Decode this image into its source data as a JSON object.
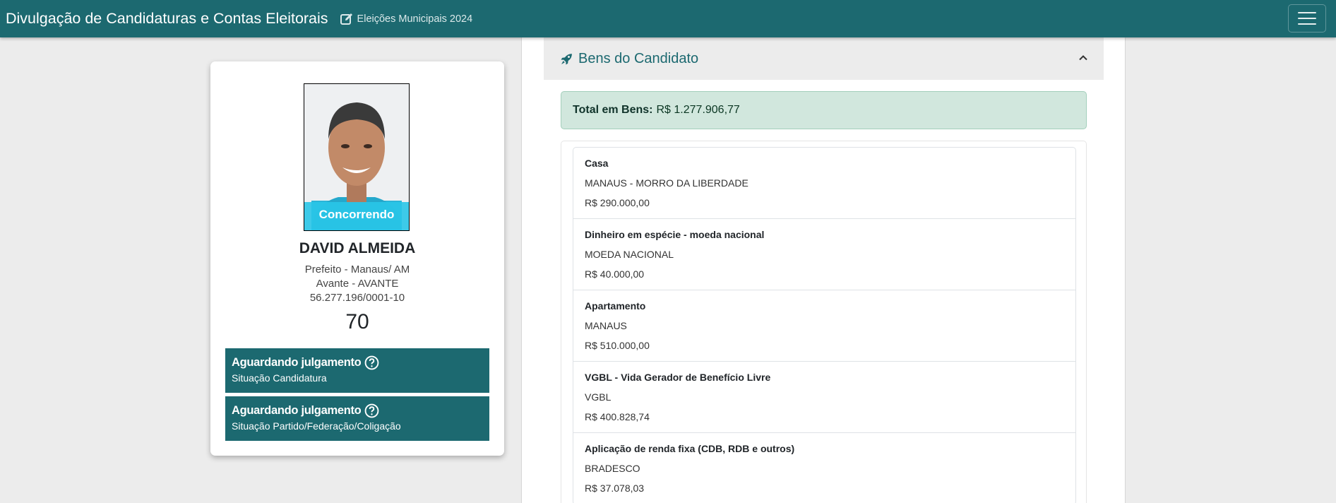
{
  "navbar": {
    "brand": "Divulgação de Candidaturas e Contas Eleitorais",
    "election": "Eleições Municipais 2024",
    "election_icon": "edit-icon",
    "menu_icon": "hamburger-menu-icon",
    "background_color": "#1c6970"
  },
  "candidate": {
    "photo_badge": "Concorrendo",
    "name": "DAVID ALMEIDA",
    "office": "Prefeito - Manaus/ AM",
    "party": "Avante - AVANTE",
    "cnpj": "56.277.196/0001-10",
    "number": "70",
    "status": [
      {
        "title": "Aguardando julgamento",
        "subtitle": "Situação Candidatura",
        "icon": "question-circle-icon"
      },
      {
        "title": "Aguardando julgamento",
        "subtitle": "Situação Partido/Federação/Coligação",
        "icon": "question-circle-icon"
      }
    ]
  },
  "assets": {
    "header_title": "Bens do Candidato",
    "header_icon": "rocket-icon",
    "collapse_icon": "chevron-up-icon",
    "total_label": "Total em Bens:",
    "total_value": "R$ 1.277.906,77",
    "items": [
      {
        "title": "Casa",
        "description": "MANAUS - MORRO DA LIBERDADE",
        "value": "R$ 290.000,00"
      },
      {
        "title": "Dinheiro em espécie - moeda nacional",
        "description": "MOEDA NACIONAL",
        "value": "R$ 40.000,00"
      },
      {
        "title": "Apartamento",
        "description": "MANAUS",
        "value": "R$ 510.000,00"
      },
      {
        "title": "VGBL - Vida Gerador de Benefício Livre",
        "description": "VGBL",
        "value": "R$ 400.828,74"
      },
      {
        "title": "Aplicação de renda fixa (CDB, RDB e outros)",
        "description": "BRADESCO",
        "value": "R$ 37.078,03"
      }
    ]
  }
}
